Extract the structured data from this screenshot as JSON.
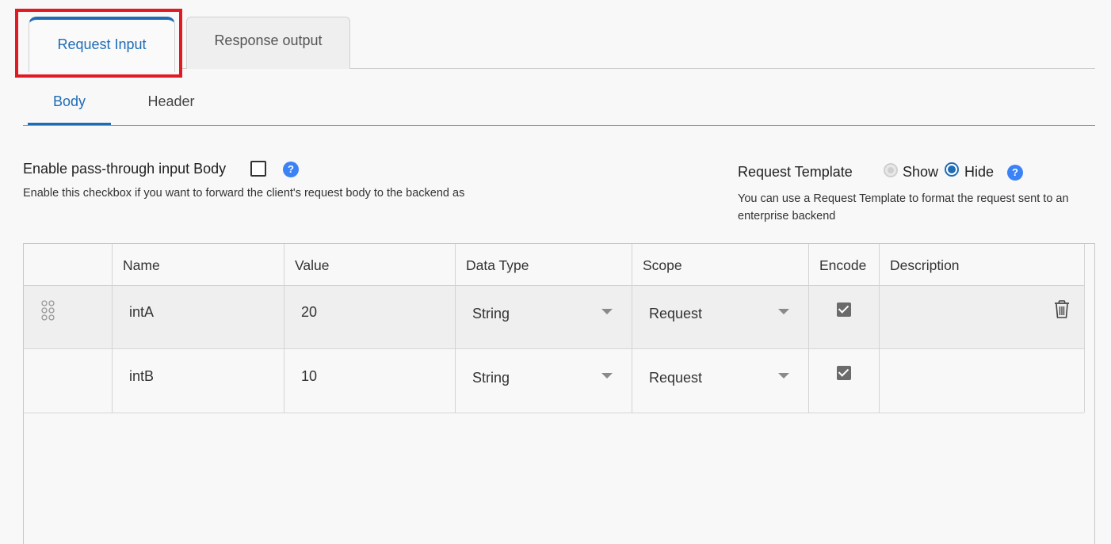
{
  "tabs": {
    "request_input": "Request Input",
    "response_output": "Response output"
  },
  "subtabs": {
    "body": "Body",
    "header": "Header"
  },
  "pass_through": {
    "label": "Enable pass-through input Body",
    "checked": false,
    "description": "Enable this checkbox if you want to forward the client's request body to the backend as"
  },
  "request_template": {
    "label": "Request Template",
    "show_label": "Show",
    "hide_label": "Hide",
    "selected": "Hide",
    "description": "You can use a Request Template to format the request sent to an enterprise backend"
  },
  "table": {
    "columns": [
      "Name",
      "Value",
      "Data Type",
      "Scope",
      "Encode",
      "Description"
    ],
    "rows": [
      {
        "name": "intA",
        "value": "20",
        "data_type": "String",
        "scope": "Request",
        "encode": true,
        "description": ""
      },
      {
        "name": "intB",
        "value": "10",
        "data_type": "String",
        "scope": "Request",
        "encode": true,
        "description": ""
      }
    ]
  },
  "colors": {
    "accent": "#1f6cb5",
    "highlight": "#e01a22",
    "help": "#3b82f6"
  }
}
